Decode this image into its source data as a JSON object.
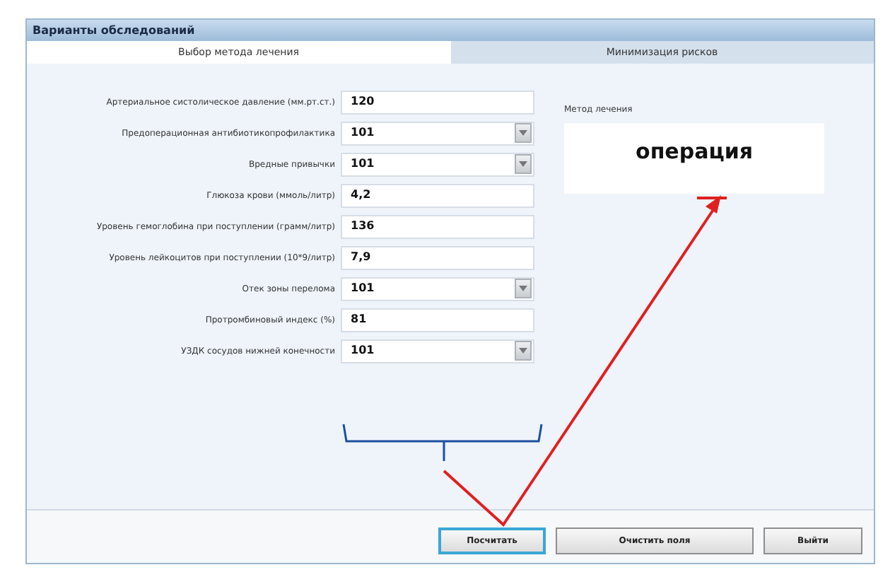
{
  "window": {
    "title": "Варианты обследований"
  },
  "tabs": [
    {
      "label": "Выбор метода лечения",
      "selected": true
    },
    {
      "label": "Минимизация рисков",
      "selected": false
    }
  ],
  "fields": [
    {
      "label": "Артериальное систолическое давление (мм.рт.ст.)",
      "value": "120",
      "kind": "text"
    },
    {
      "label": "Предоперационная антибиотикопрофилактика",
      "value": "101",
      "kind": "combo"
    },
    {
      "label": "Вредные привычки",
      "value": "101",
      "kind": "combo"
    },
    {
      "label": "Глюкоза крови (ммоль/литр)",
      "value": "4,2",
      "kind": "text"
    },
    {
      "label": "Уровень гемоглобина при поступлении (грамм/литр)",
      "value": "136",
      "kind": "text"
    },
    {
      "label": "Уровень лейкоцитов при поступлении (10*9/литр)",
      "value": "7,9",
      "kind": "text"
    },
    {
      "label": "Отек зоны перелома",
      "value": "101",
      "kind": "combo"
    },
    {
      "label": "Протромбиновый индекс (%)",
      "value": "81",
      "kind": "text"
    },
    {
      "label": "УЗДК сосудов нижней конечности",
      "value": "101",
      "kind": "combo"
    }
  ],
  "result": {
    "label": "Метод лечения",
    "value": "операция"
  },
  "buttons": [
    {
      "label": "Посчитать",
      "focused": true
    },
    {
      "label": "Очистить поля",
      "focused": false
    },
    {
      "label": "Выйти",
      "focused": false
    }
  ]
}
